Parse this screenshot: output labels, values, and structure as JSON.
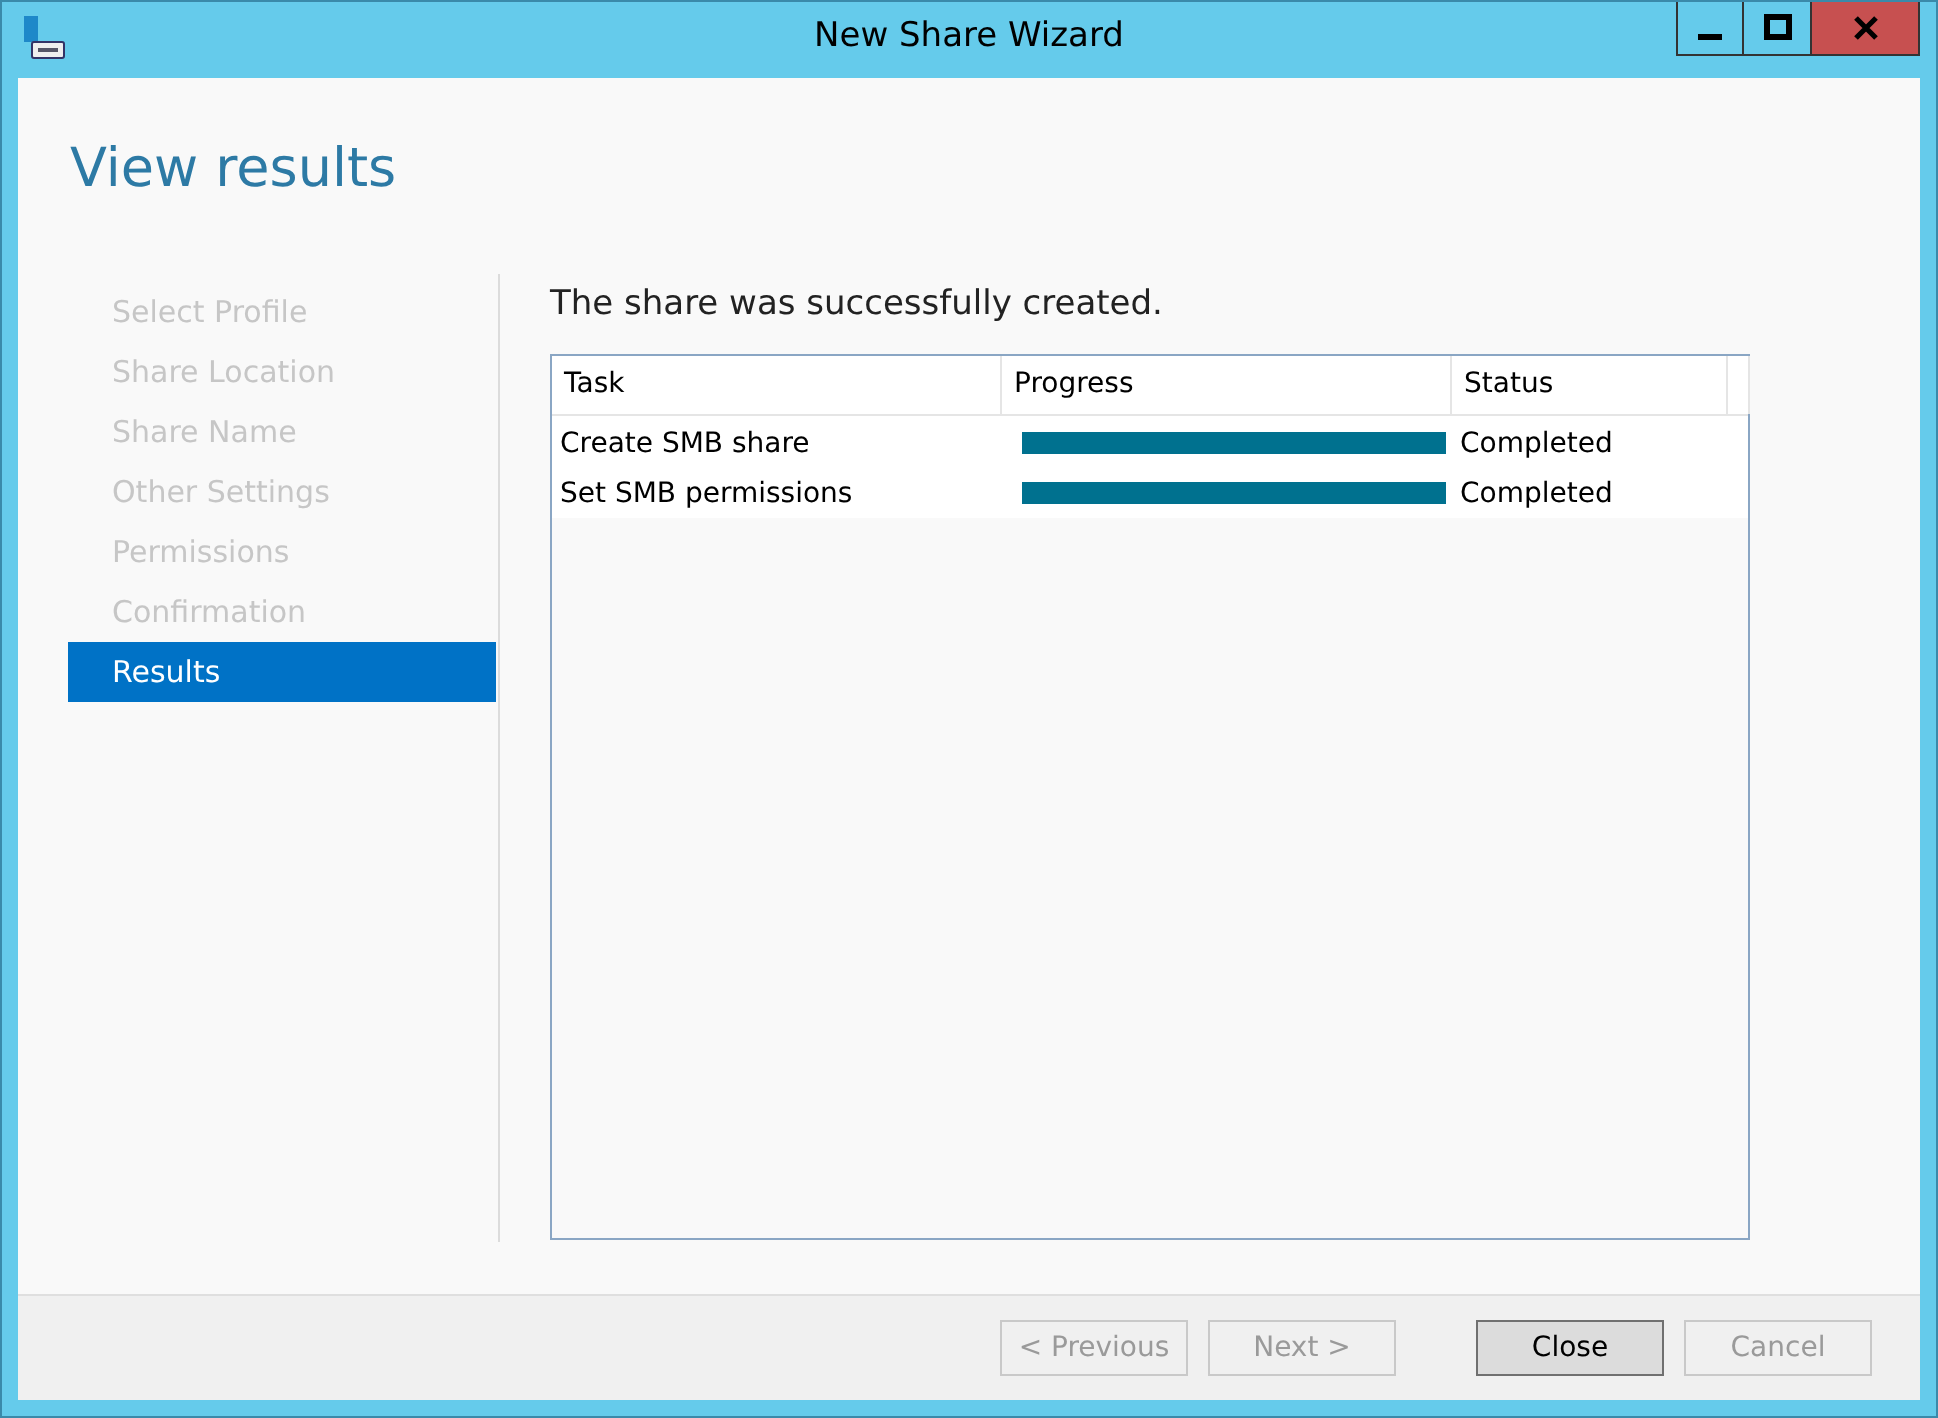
{
  "window": {
    "title": "New Share Wizard"
  },
  "page_title": "View results",
  "steps": [
    {
      "label": "Select Profile",
      "selected": false
    },
    {
      "label": "Share Location",
      "selected": false
    },
    {
      "label": "Share Name",
      "selected": false
    },
    {
      "label": "Other Settings",
      "selected": false
    },
    {
      "label": "Permissions",
      "selected": false
    },
    {
      "label": "Confirmation",
      "selected": false
    },
    {
      "label": "Results",
      "selected": true
    }
  ],
  "message": "The share was successfully created.",
  "table": {
    "columns": [
      "Task",
      "Progress",
      "Status"
    ],
    "rows": [
      {
        "task": "Create SMB share",
        "level": 1,
        "status": "Completed"
      },
      {
        "task": "Set SMB permissions",
        "level": 1,
        "status": "Completed"
      }
    ]
  },
  "buttons": [
    {
      "label": "< Previous",
      "disabled": true,
      "default": false
    },
    {
      "label": "Next >",
      "disabled": true,
      "default": false
    },
    {
      "label": "Close",
      "disabled": false,
      "default": true
    },
    {
      "label": "Cancel",
      "disabled": true,
      "default": false
    }
  ]
}
